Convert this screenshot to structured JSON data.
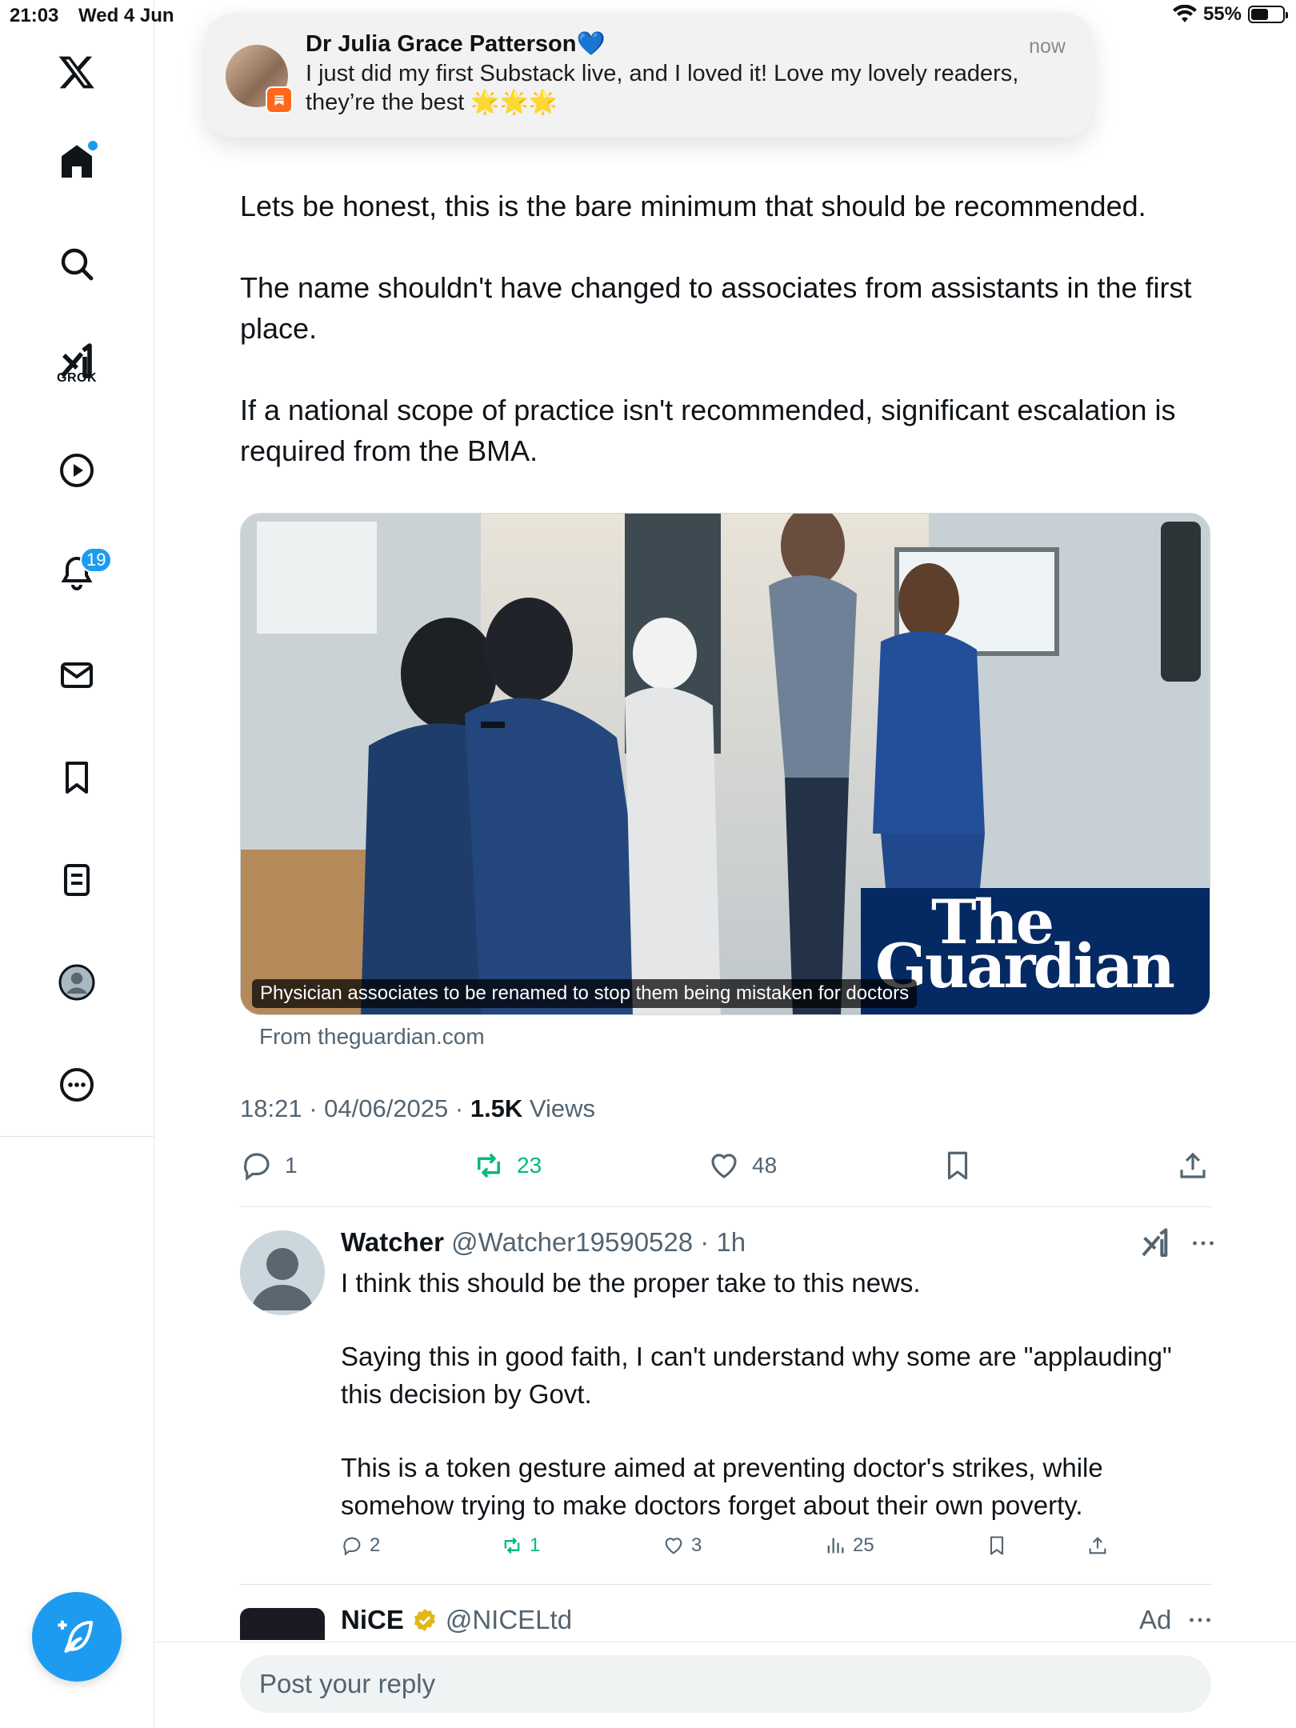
{
  "status_bar": {
    "time": "21:03",
    "date": "Wed 4 Jun",
    "battery": "55%",
    "battery_level": 0.55
  },
  "sidebar": {
    "items": [
      {
        "icon": "x-logo-icon"
      },
      {
        "icon": "home-icon",
        "has_dot": true
      },
      {
        "icon": "search-icon"
      },
      {
        "icon": "grok-icon",
        "label": "GROK"
      },
      {
        "icon": "video-play-icon"
      },
      {
        "icon": "notifications-bell-icon",
        "badge": "19"
      },
      {
        "icon": "messages-mail-icon"
      },
      {
        "icon": "bookmarks-icon"
      },
      {
        "icon": "lists-icon"
      },
      {
        "icon": "profile-avatar-icon"
      },
      {
        "icon": "more-icon"
      }
    ],
    "compose_icon": "compose-feather-icon"
  },
  "notification": {
    "title": "Dr Julia Grace Patterson💙",
    "time": "now",
    "body": "I just did my first Substack live, and I loved it! Love my lovely readers, they’re the best 🌟🌟🌟",
    "app_icon": "substack-icon"
  },
  "tweet": {
    "paragraphs": [
      "Lets be honest, this is the bare minimum that should be recommended.",
      "The name shouldn't have changed to associates from assistants in the first place.",
      "If a national scope of practice isn't recommended, significant escalation is required from the BMA."
    ],
    "card": {
      "caption": "Physician associates to be renamed to stop them being mistaken for doctors",
      "logo_line1": "The",
      "logo_line2": "Guardian",
      "source": "From theguardian.com"
    },
    "timestamp": "18:21 · 04/06/2025 · ",
    "views_count": "1.5K",
    "views_label": " Views",
    "actions": {
      "replies": "1",
      "reposts": "23",
      "likes": "48"
    }
  },
  "reply": {
    "name": "Watcher",
    "handle": "@Watcher19590528",
    "time": " · 1h",
    "paragraphs": [
      "I think this should be the proper take to this news.",
      "Saying this in good faith, I can't understand why some are \"applauding\" this decision by Govt.",
      "This is a token gesture aimed at preventing doctor's strikes, while somehow trying to make doctors forget about their own poverty."
    ],
    "actions": {
      "replies": "2",
      "reposts": "1",
      "likes": "3",
      "views": "25"
    }
  },
  "ad": {
    "name": "NiCE",
    "handle": "@NICELtd",
    "label": "Ad"
  },
  "reply_input": {
    "placeholder": "Post your reply"
  },
  "colors": {
    "accent": "#1d9bf0",
    "repost_green": "#00ba7c",
    "guardian_blue": "#052962",
    "substack_orange": "#ff6719"
  }
}
